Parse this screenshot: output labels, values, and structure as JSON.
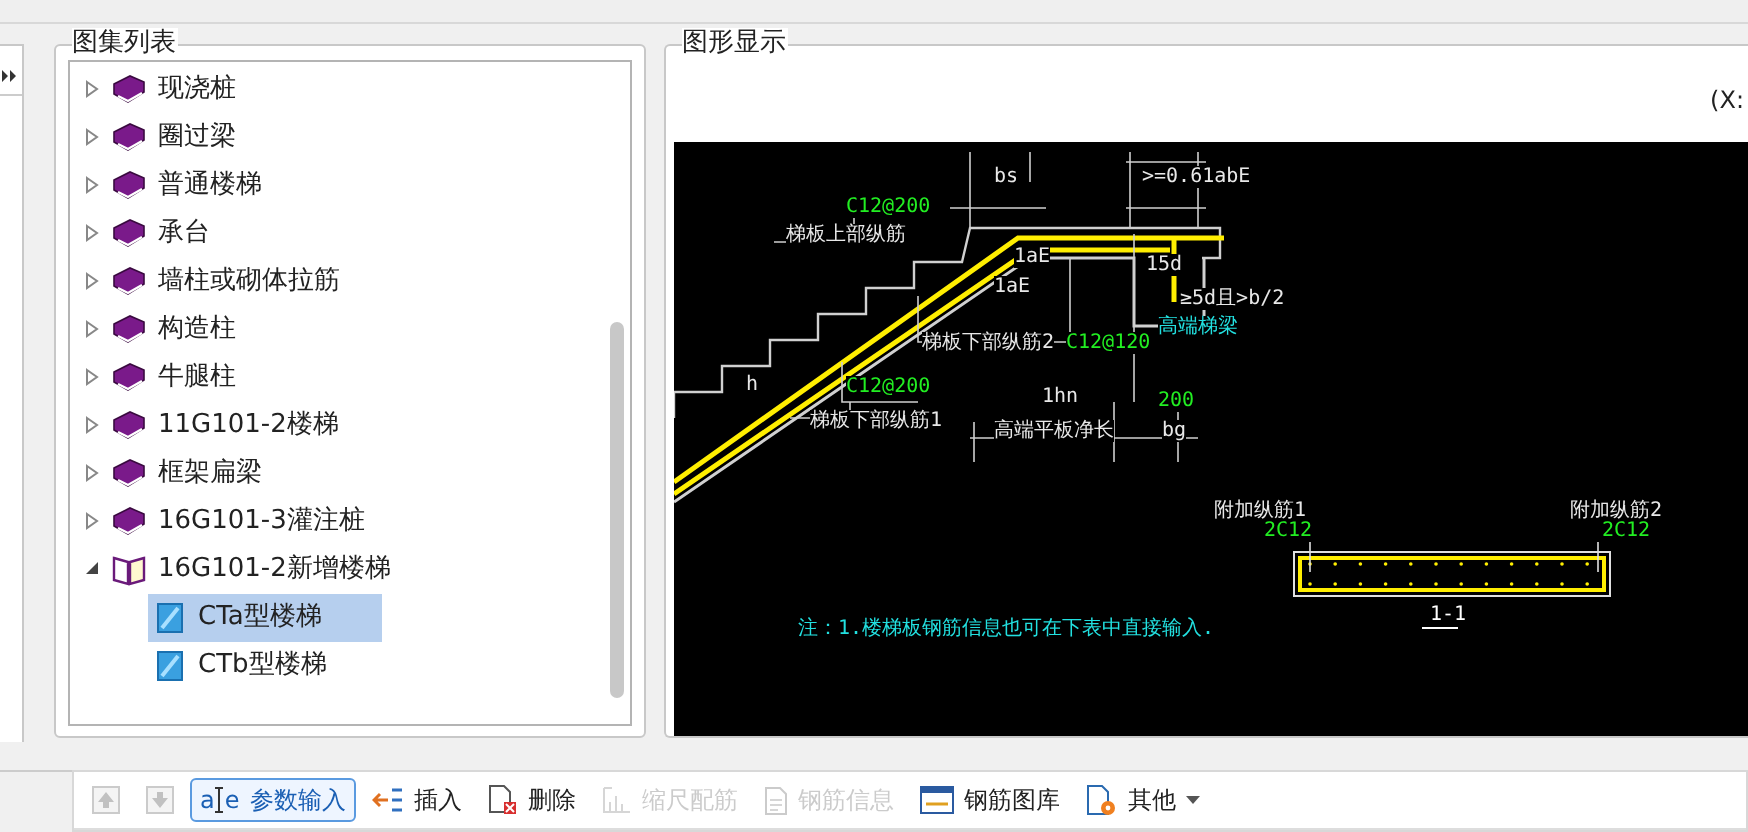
{
  "tree_panel": {
    "title": "图集列表",
    "items": [
      {
        "label": "现浇桩",
        "expanded": false,
        "selected": false
      },
      {
        "label": "圈过梁",
        "expanded": false,
        "selected": false
      },
      {
        "label": "普通楼梯",
        "expanded": false,
        "selected": false
      },
      {
        "label": "承台",
        "expanded": false,
        "selected": false
      },
      {
        "label": "墙柱或砌体拉筋",
        "expanded": false,
        "selected": false
      },
      {
        "label": "构造柱",
        "expanded": false,
        "selected": false
      },
      {
        "label": "牛腿柱",
        "expanded": false,
        "selected": false
      },
      {
        "label": "11G101-2楼梯",
        "expanded": false,
        "selected": false
      },
      {
        "label": "框架扁梁",
        "expanded": false,
        "selected": false
      },
      {
        "label": "16G101-3灌注桩",
        "expanded": false,
        "selected": false
      },
      {
        "label": "16G101-2新增楼梯",
        "expanded": true,
        "selected": false,
        "children": [
          {
            "label": "CTa型楼梯",
            "selected": true
          },
          {
            "label": "CTb型楼梯",
            "selected": false
          }
        ]
      }
    ]
  },
  "graphics_panel": {
    "title": "图形显示",
    "coords": "(X:",
    "labels": [
      {
        "text": "bs",
        "kind": "dim"
      },
      {
        "text": ">=0.61abE",
        "kind": "dim"
      },
      {
        "text": "C12@200",
        "kind": "spec"
      },
      {
        "text": "梯板上部纵筋",
        "kind": "name"
      },
      {
        "text": "1aE",
        "kind": "dim"
      },
      {
        "text": "15d",
        "kind": "dim"
      },
      {
        "text": "1aE",
        "kind": "dim"
      },
      {
        "text": "≥5d且>b/2",
        "kind": "dim"
      },
      {
        "text": "高端梯梁",
        "kind": "note"
      },
      {
        "text": "梯板下部纵筋2",
        "kind": "name"
      },
      {
        "text": "C12@120",
        "kind": "spec"
      },
      {
        "text": "h",
        "kind": "dim"
      },
      {
        "text": "C12@200",
        "kind": "spec"
      },
      {
        "text": "1hn",
        "kind": "dim"
      },
      {
        "text": "200",
        "kind": "spec"
      },
      {
        "text": "梯板下部纵筋1",
        "kind": "name"
      },
      {
        "text": "高端平板净长",
        "kind": "name"
      },
      {
        "text": "bg",
        "kind": "dim"
      },
      {
        "text": "附加纵筋1",
        "kind": "name"
      },
      {
        "text": "2C12",
        "kind": "spec"
      },
      {
        "text": "附加纵筋2",
        "kind": "name"
      },
      {
        "text": "2C12",
        "kind": "spec"
      },
      {
        "text": "1-1",
        "kind": "title"
      },
      {
        "text": "注：1.楼梯板钢筋信息也可在下表中直接输入.",
        "kind": "note"
      }
    ]
  },
  "toolbar": [
    {
      "kind": "up",
      "disabled": true,
      "selected": false
    },
    {
      "kind": "down",
      "disabled": true,
      "selected": false
    },
    {
      "kind": "params",
      "icon_letters": [
        "a",
        "e"
      ],
      "label": "参数输入",
      "disabled": false,
      "selected": true
    },
    {
      "kind": "insert",
      "label": "插入",
      "disabled": false,
      "selected": false
    },
    {
      "kind": "delete",
      "label": "删除",
      "disabled": false,
      "selected": false
    },
    {
      "kind": "scale",
      "label": "缩尺配筋",
      "disabled": true,
      "selected": false
    },
    {
      "kind": "info",
      "label": "钢筋信息",
      "disabled": true,
      "selected": false
    },
    {
      "kind": "library",
      "label": "钢筋图库",
      "disabled": false,
      "selected": false
    },
    {
      "kind": "other",
      "label": "其他",
      "disabled": false,
      "selected": false
    }
  ]
}
